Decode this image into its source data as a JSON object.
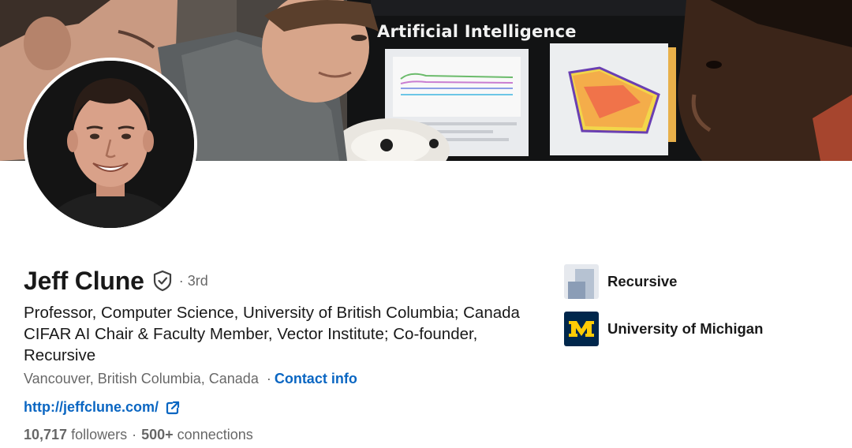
{
  "banner": {
    "sign_text": "Artificial Intelligence"
  },
  "profile": {
    "name": "Jeff Clune",
    "degree": "3rd",
    "headline": "Professor, Computer Science, University of British Columbia; Canada CIFAR AI Chair & Faculty Member, Vector Institute; Co-founder, Recursive",
    "location": "Vancouver, British Columbia, Canada",
    "contact_label": "Contact info",
    "website": "http://jeffclune.com/",
    "followers_count": "10,717",
    "followers_label": "followers",
    "connections_count": "500+",
    "connections_label": "connections"
  },
  "organizations": [
    {
      "name": "Recursive",
      "logo_icon": "recursive-logo"
    },
    {
      "name": "University of Michigan",
      "logo_icon": "block-m-logo"
    }
  ],
  "colors": {
    "link": "#0a66c2",
    "secondary_text": "rgba(0,0,0,0.6)",
    "michigan_blue": "#00274c",
    "michigan_maize": "#ffcb05"
  }
}
